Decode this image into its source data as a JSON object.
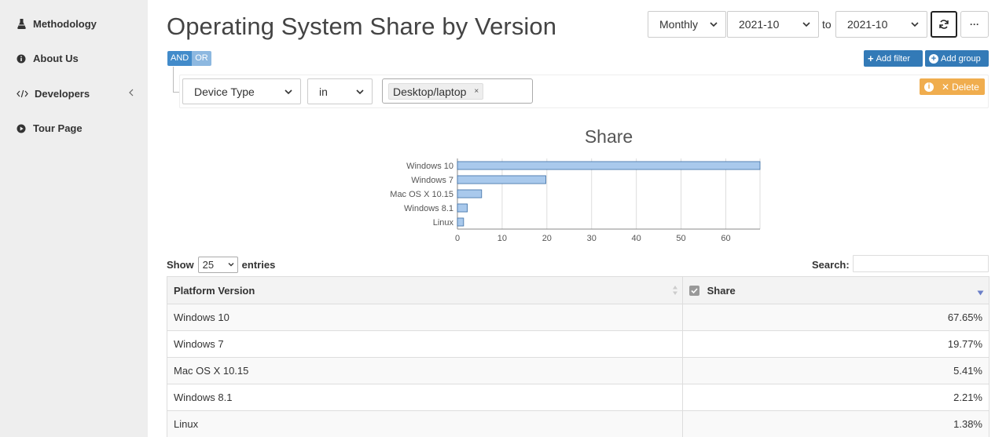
{
  "sidebar": {
    "items": [
      {
        "label": "Methodology",
        "icon": "flask-icon"
      },
      {
        "label": "About Us",
        "icon": "info-icon"
      },
      {
        "label": "Developers",
        "icon": "code-icon"
      },
      {
        "label": "Tour Page",
        "icon": "play-icon"
      }
    ]
  },
  "header": {
    "title": "Operating System Share by Version",
    "period": "Monthly",
    "from": "2021-10",
    "to_label": "to",
    "to": "2021-10",
    "more_label": "···"
  },
  "builder": {
    "and_label": "AND",
    "or_label": "OR",
    "add_filter_label": "Add filter",
    "add_group_label": "Add group",
    "field": "Device Type",
    "operator": "in",
    "tag_value": "Desktop/laptop",
    "tag_remove": "×",
    "delete_label": "Delete"
  },
  "chart_data": {
    "type": "bar",
    "orientation": "horizontal",
    "title": "Share",
    "categories": [
      "Windows 10",
      "Windows 7",
      "Mac OS X 10.15",
      "Windows 8.1",
      "Linux"
    ],
    "values": [
      67.65,
      19.77,
      5.41,
      2.21,
      1.38
    ],
    "xlim": [
      0,
      67.65
    ],
    "xticks": [
      0,
      10,
      20,
      30,
      40,
      50,
      60
    ],
    "grid": true,
    "bar_color": "#a9c9ec",
    "bar_stroke": "#3b6ea5"
  },
  "table_controls": {
    "show_label": "Show",
    "page_size": "25",
    "entries_label": "entries",
    "search_label": "Search:"
  },
  "table": {
    "columns": [
      "Platform Version",
      "Share"
    ],
    "rows": [
      [
        "Windows 10",
        "67.65%"
      ],
      [
        "Windows 7",
        "19.77%"
      ],
      [
        "Mac OS X 10.15",
        "5.41%"
      ],
      [
        "Windows 8.1",
        "2.21%"
      ],
      [
        "Linux",
        "1.38%"
      ]
    ]
  },
  "colors": {
    "sidebar_bg": "#eeeeee",
    "primary": "#337ab7",
    "warning": "#f0ad4e"
  }
}
